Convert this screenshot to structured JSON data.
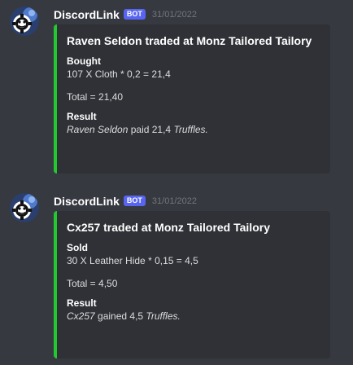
{
  "messages": [
    {
      "author": "DiscordLink",
      "bot_tag": "BOT",
      "timestamp": "31/01/2022",
      "embed": {
        "accent": "#22c930",
        "title": "Raven Seldon traded at Monz Tailored Tailory",
        "fields": [
          {
            "name": "Bought",
            "value": "107 X Cloth * 0,2 = 21,4"
          }
        ],
        "total": "Total = 21,40",
        "result": {
          "name": "Result",
          "actor": "Raven Seldon",
          "verb": " paid 21,4 ",
          "item": "Truffles."
        }
      }
    },
    {
      "author": "DiscordLink",
      "bot_tag": "BOT",
      "timestamp": "31/01/2022",
      "embed": {
        "accent": "#22c930",
        "title": "Cx257 traded at Monz Tailored Tailory",
        "fields": [
          {
            "name": "Sold",
            "value": "30 X Leather Hide * 0,15 = 4,5"
          }
        ],
        "total": "Total = 4,50",
        "result": {
          "name": "Result",
          "actor": "Cx257",
          "verb": " gained 4,5 ",
          "item": "Truffles."
        }
      }
    }
  ],
  "colors": {
    "background": "#36393f",
    "embed_bg": "#2f3136",
    "accent": "#22c930",
    "bot_tag": "#5865f2"
  },
  "icons": {
    "avatar": "discordlink-gear-avatar-icon"
  }
}
